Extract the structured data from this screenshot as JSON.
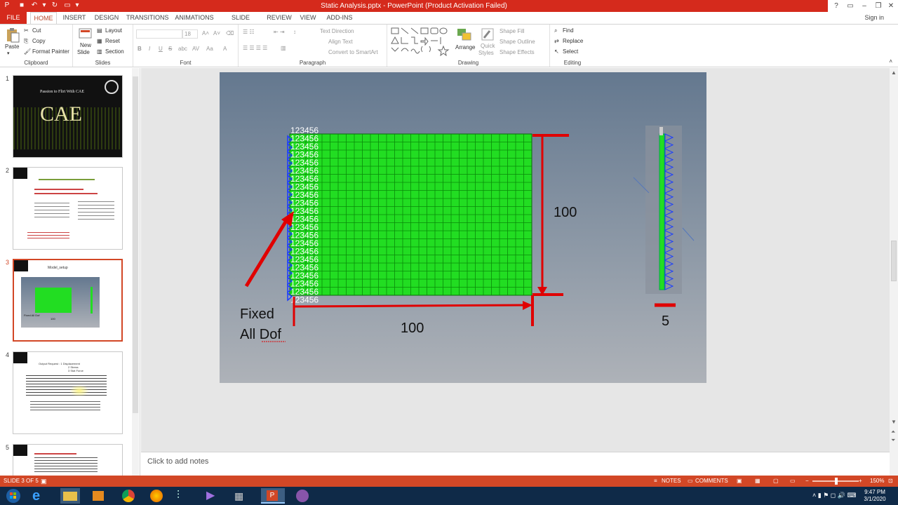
{
  "window": {
    "title": "Static Analysis.pptx - PowerPoint (Product Activation Failed)",
    "help": "?",
    "sign_in": "Sign in"
  },
  "tabs": [
    "FILE",
    "HOME",
    "INSERT",
    "DESIGN",
    "TRANSITIONS",
    "ANIMATIONS",
    "SLIDE SHOW",
    "REVIEW",
    "VIEW",
    "ADD-INS"
  ],
  "ribbon": {
    "clipboard": {
      "label": "Clipboard",
      "paste": "Paste",
      "cut": "Cut",
      "copy": "Copy",
      "format_painter": "Format Painter"
    },
    "slides": {
      "label": "Slides",
      "new_slide": "New",
      "new_slide2": "Slide",
      "layout": "Layout",
      "reset": "Reset",
      "section": "Section"
    },
    "font": {
      "label": "Font",
      "size": "18",
      "bold": "B",
      "italic": "I",
      "underline": "U",
      "strike": "S",
      "shadow": "abc",
      "spacing": "AV",
      "case": "Aa",
      "color": "A"
    },
    "paragraph": {
      "label": "Paragraph",
      "text_direction": "Text Direction",
      "align_text": "Align Text",
      "smartart": "Convert to SmartArt"
    },
    "drawing": {
      "label": "Drawing",
      "arrange": "Arrange",
      "quick_styles": "Quick",
      "quick_styles2": "Styles",
      "shape_fill": "Shape Fill",
      "shape_outline": "Shape Outline",
      "shape_effects": "Shape Effects"
    },
    "editing": {
      "label": "Editing",
      "find": "Find",
      "replace": "Replace",
      "select": "Select"
    }
  },
  "thumbnails": [
    {
      "num": "1",
      "title": "Passion to Flirt With CAE",
      "big": "CAE"
    },
    {
      "num": "2"
    },
    {
      "num": "3",
      "title": "Model_setup",
      "fixed": "Fixed All Dof",
      "w": "100"
    },
    {
      "num": "4",
      "title": "Output Request : 1 Displacement",
      "sub1": "2 Stress",
      "sub2": "3 Stat Force"
    },
    {
      "num": "5"
    }
  ],
  "slide": {
    "node_labels": [
      "123456",
      "123456",
      "123456",
      "123456",
      "123456",
      "123456",
      "123456",
      "123456",
      "123456",
      "123456",
      "123456",
      "123456",
      "123456",
      "123456",
      "123456",
      "123456",
      "123456",
      "123456",
      "123456",
      "123456",
      "123456",
      "123456"
    ],
    "height_dim": "100",
    "width_dim": "100",
    "fixed_label_line1": "Fixed",
    "fixed_label_line2": "All Dof",
    "thickness_dim": "5"
  },
  "notes": {
    "placeholder": "Click to add notes"
  },
  "status": {
    "slide_of": "SLIDE 3 OF 5",
    "notes": "NOTES",
    "comments": "COMMENTS",
    "zoom": "150%"
  },
  "taskbar": {
    "time": "9:47 PM",
    "date": "3/1/2020"
  },
  "colors": {
    "accent": "#d24726",
    "mesh": "#22dd22",
    "constraint": "#1a3cff",
    "dimension": "#e00000"
  }
}
